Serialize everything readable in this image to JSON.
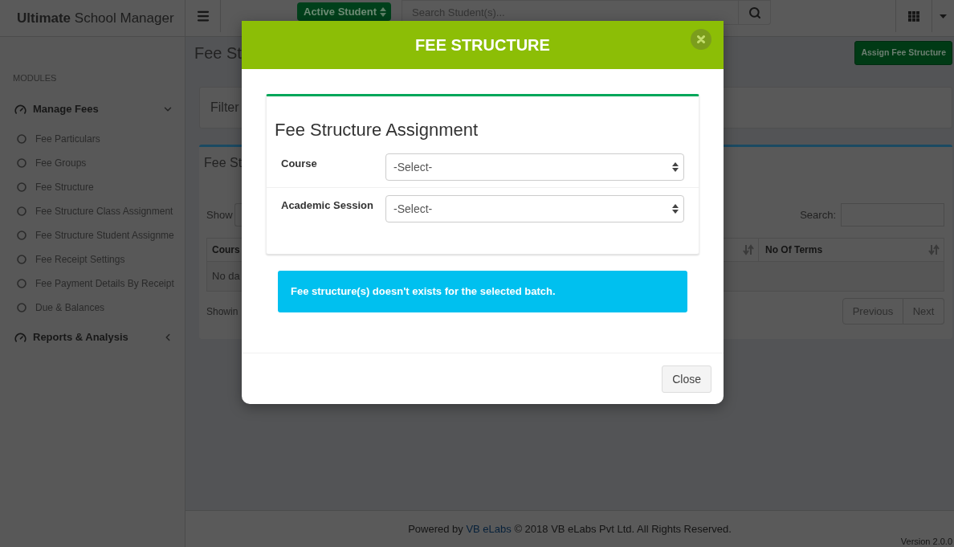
{
  "header": {
    "logo": "**Ultimate** School Manager",
    "status_filter": "Active Student",
    "search": {
      "placeholder": "Search Student(s)..."
    }
  },
  "sidebar": {
    "section": "MODULES",
    "groups": [
      {
        "label": "Manage Fees",
        "expanded": true,
        "children": [
          {
            "label": "Fee Particulars"
          },
          {
            "label": "Fee Groups"
          },
          {
            "label": "Fee Structure"
          },
          {
            "label": "Fee Structure Class Assignment"
          },
          {
            "label": "Fee Structure Student Assignme"
          },
          {
            "label": "Fee Receipt Settings"
          },
          {
            "label": "Fee Payment Details By Receipt"
          },
          {
            "label": "Due & Balances"
          }
        ]
      },
      {
        "label": "Reports & Analysis",
        "expanded": false
      }
    ]
  },
  "page": {
    "title": "Fee St",
    "action_button": "Assign Fee Structure",
    "filter_panel": {
      "title": "Filter"
    },
    "table_panel": {
      "title": "Fee St",
      "show_label": "Show",
      "search_label": "Search:",
      "columns": [
        {
          "label": "Cours"
        },
        {
          "label": "No Of Terms"
        }
      ],
      "empty_message": "No da",
      "info": "Showin",
      "pagination": [
        "Previous",
        "Next"
      ]
    }
  },
  "modal": {
    "title": "FEE STRUCTURE",
    "form_title": "Fee Structure Assignment",
    "fields": [
      {
        "label": "Course",
        "value": "-Select-"
      },
      {
        "label": "Academic Session",
        "value": "-Select-"
      }
    ],
    "alert": "Fee structure(s) doesn't exists for the selected batch.",
    "buttons": [
      "Close"
    ]
  },
  "footer": {
    "powered_by": "Powered by",
    "link": "VB eLabs",
    "copyright": "© 2018 VB eLabs Pvt Ltd. All Rights Reserved.",
    "version": "Version 2.0.0"
  }
}
